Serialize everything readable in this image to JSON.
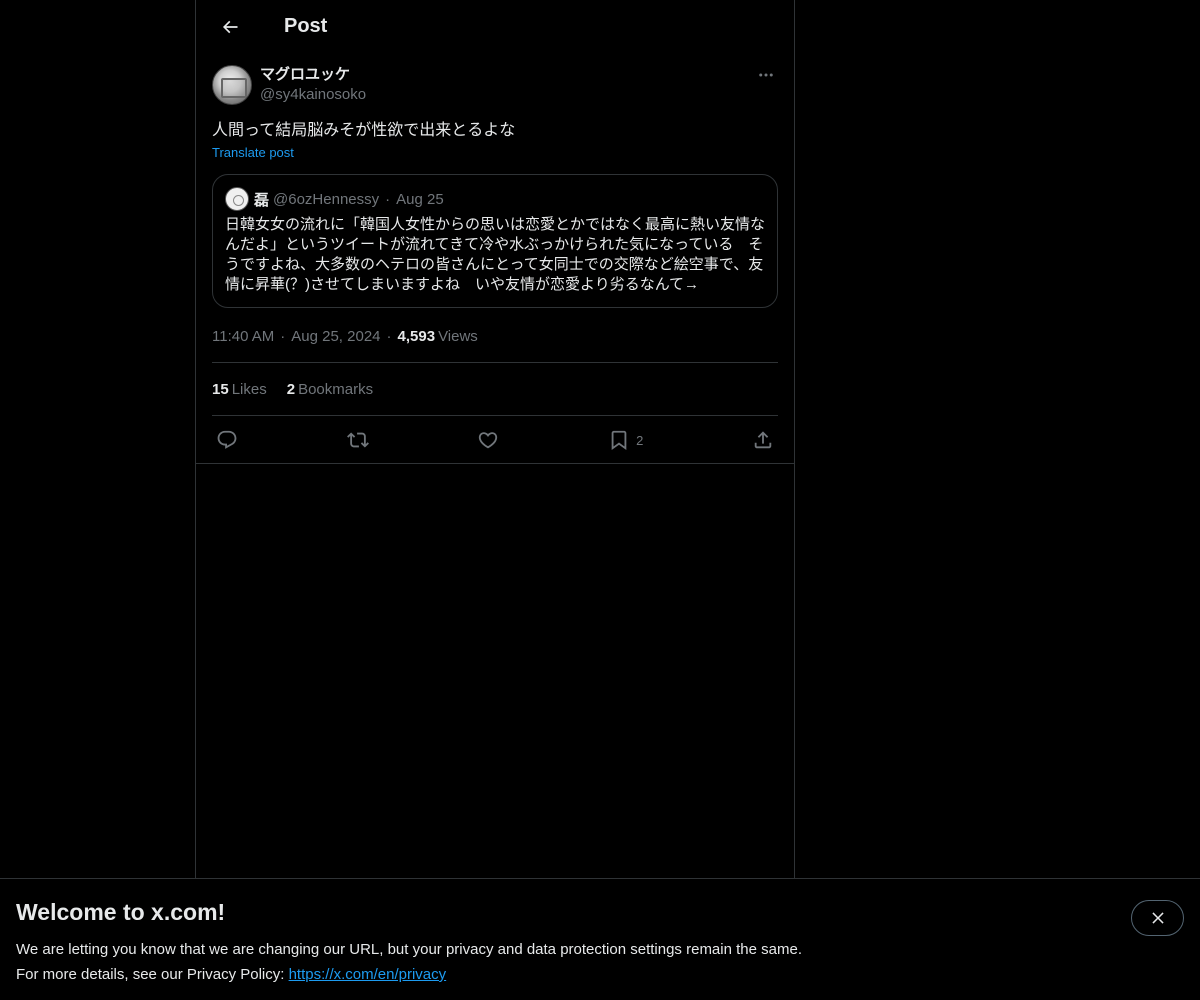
{
  "header": {
    "title": "Post"
  },
  "post": {
    "author": {
      "display_name": "マグロユッケ",
      "handle": "@sy4kainosoko"
    },
    "text": "人間って結局脳みそが性欲で出来とるよな",
    "translate_label": "Translate post",
    "quote": {
      "author_name": "磊",
      "author_handle": "@6ozHennessy",
      "dot": "·",
      "date": "Aug 25",
      "text": "日韓女女の流れに「韓国人女性からの思いは恋愛とかではなく最高に熱い友情なんだよ」というツイートが流れてきて冷や水ぶっかけられた気になっている　そうですよね、大多数のヘテロの皆さんにとって女同士での交際など絵空事で、友情に昇華(？)させてしまいますよね　いや友情が恋愛より劣るなんて→"
    },
    "meta": {
      "time": "11:40 AM",
      "sep": "·",
      "date": "Aug 25, 2024",
      "views_count": "4,593",
      "views_label": "Views"
    },
    "stats": {
      "likes_count": "15",
      "likes_label": "Likes",
      "bookmarks_count": "2",
      "bookmarks_label": "Bookmarks"
    },
    "actions": {
      "bookmark_count": "2"
    }
  },
  "banner": {
    "title": "Welcome to x.com!",
    "line1": "We are letting you know that we are changing our URL, but your privacy and data protection settings remain the same.",
    "line2_prefix": "For more details, see our Privacy Policy: ",
    "link": "https://x.com/en/privacy"
  },
  "colors": {
    "background": "#000000",
    "text": "#e7e9ea",
    "muted": "#71767b",
    "accent": "#1d9bf0",
    "border": "#2f3336"
  },
  "icons": [
    "back-arrow-icon",
    "more-icon",
    "reply-icon",
    "repost-icon",
    "like-icon",
    "bookmark-icon",
    "share-icon",
    "close-icon"
  ]
}
